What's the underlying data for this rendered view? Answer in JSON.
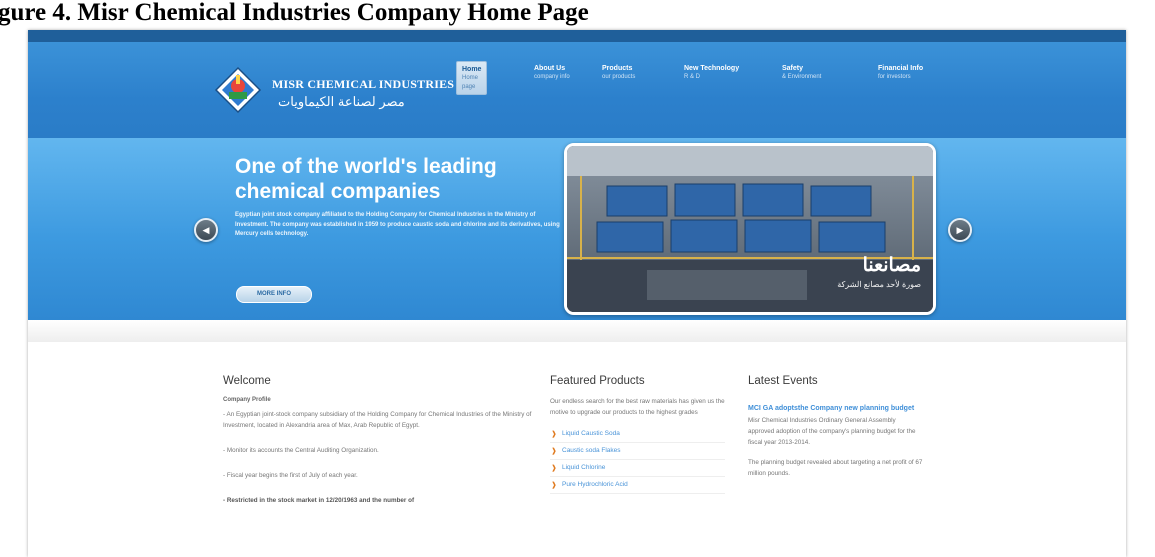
{
  "caption": "gure 4. Misr Chemical Industries Company Home Page",
  "top_link": "",
  "brand": {
    "name_en": "MISR CHEMICAL INDUSTRIES",
    "name_ar": "مصر لصناعة الكيماويات"
  },
  "nav": [
    {
      "title": "Home",
      "sub": "Home page",
      "active": true
    },
    {
      "title": "About Us",
      "sub": "company info"
    },
    {
      "title": "Products",
      "sub": "our products"
    },
    {
      "title": "New Technology",
      "sub": "R & D"
    },
    {
      "title": "Safety",
      "sub": "& Environment"
    },
    {
      "title": "Financial Info",
      "sub": "for investors"
    }
  ],
  "hero": {
    "title": "One of the world's leading chemical companies",
    "text": "Egyptian joint stock company affiliated to the Holding Company for Chemical Industries in the Ministry of Investment. The company was established in 1959 to produce caustic soda and chlorine and its derivatives, using Mercury cells technology.",
    "button": "MORE INFO",
    "slide_caption_main": "مصانعنا",
    "slide_caption_sub": "صورة لأحد مصانع الشركة"
  },
  "welcome": {
    "heading": "Welcome",
    "subheading": "Company Profile",
    "paragraphs": [
      "- An Egyptian joint-stock company subsidiary of the Holding Company for Chemical Industries of the Ministry of Investment, located in Alexandria area of Max, Arab Republic of Egypt.",
      "- Monitor its accounts the Central Auditing Organization.",
      "- Fiscal year begins the first of July of each year.",
      "- Restricted in the stock market in 12/20/1963 and the number of"
    ]
  },
  "featured": {
    "heading": "Featured Products",
    "intro": "Our endless search for the best raw materials has given us the motive to upgrade our products to the highest grades",
    "items": [
      "Liquid Caustic Soda",
      "Caustic soda Flakes",
      "Liquid Chlorine",
      "Pure Hydrochloric Acid"
    ]
  },
  "events": {
    "heading": "Latest Events",
    "title": "MCI GA adoptsthe Company new planning budget",
    "p1": "Misr Chemical Industries Ordinary General Assembly approved adoption of the company's planning budget for the fiscal year 2013-2014.",
    "p2": "The planning budget revealed about targeting a net profit of 67 million pounds."
  },
  "colors": {
    "header_blue": "#2c80cc",
    "hero_blue": "#3d9ae0",
    "link_blue": "#3f8fd8",
    "bullet_orange": "#e07a1f"
  },
  "icons": {
    "prev": "chevron-left-icon",
    "next": "chevron-right-icon",
    "bullet": "bullet-icon"
  }
}
